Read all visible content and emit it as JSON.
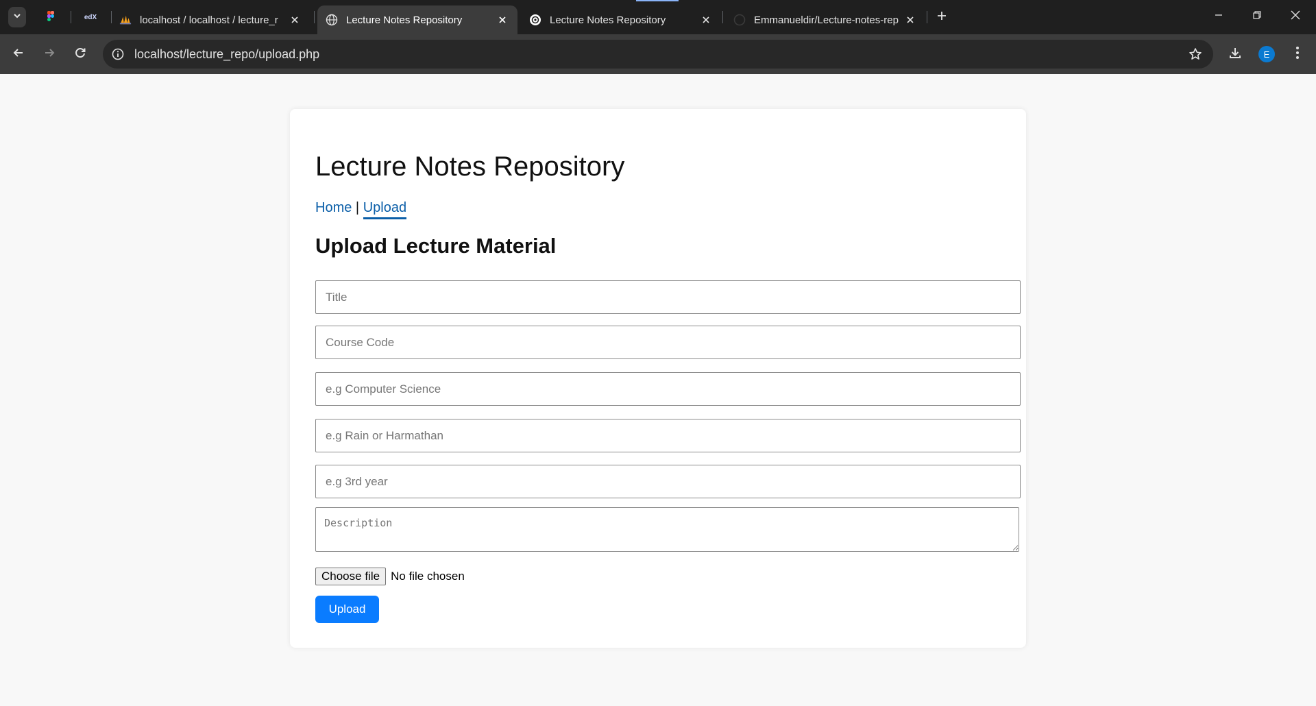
{
  "browser": {
    "tabs": [
      {
        "title": "localhost / localhost / lecture_r",
        "favicon": "phpmyadmin-icon",
        "active": false
      },
      {
        "title": "Lecture Notes Repository",
        "favicon": "globe-icon",
        "active": true
      },
      {
        "title": "Lecture Notes Repository",
        "favicon": "chatgpt-icon",
        "active": false
      },
      {
        "title": "Emmanueldir/Lecture-notes-rep",
        "favicon": "github-icon",
        "active": false
      }
    ],
    "pinned_tabs": [
      "figma-icon",
      "edx-icon"
    ],
    "edx_label": "edX",
    "address_url": "localhost/lecture_repo/upload.php",
    "profile_initial": "E",
    "colors": {
      "tabbar": "#1f1f1f",
      "toolbar": "#3c3c3c",
      "omnibox": "#282828",
      "avatar": "#0b7ad1"
    }
  },
  "page": {
    "site_title": "Lecture Notes Repository",
    "nav": {
      "home": "Home",
      "separator": "|",
      "upload": "Upload"
    },
    "heading": "Upload Lecture Material",
    "form": {
      "title_placeholder": "Title",
      "course_code_placeholder": "Course Code",
      "department_placeholder": "e.g Computer Science",
      "semester_placeholder": "e.g Rain or Harmathan",
      "level_placeholder": "e.g 3rd year",
      "description_placeholder": "Description",
      "file_button_label": "Choose file",
      "file_status": "No file chosen",
      "submit_label": "Upload"
    },
    "colors": {
      "link": "#0a5ea8",
      "primary_button": "#0a7cff",
      "background": "#f8f8f8",
      "card": "#ffffff"
    }
  }
}
